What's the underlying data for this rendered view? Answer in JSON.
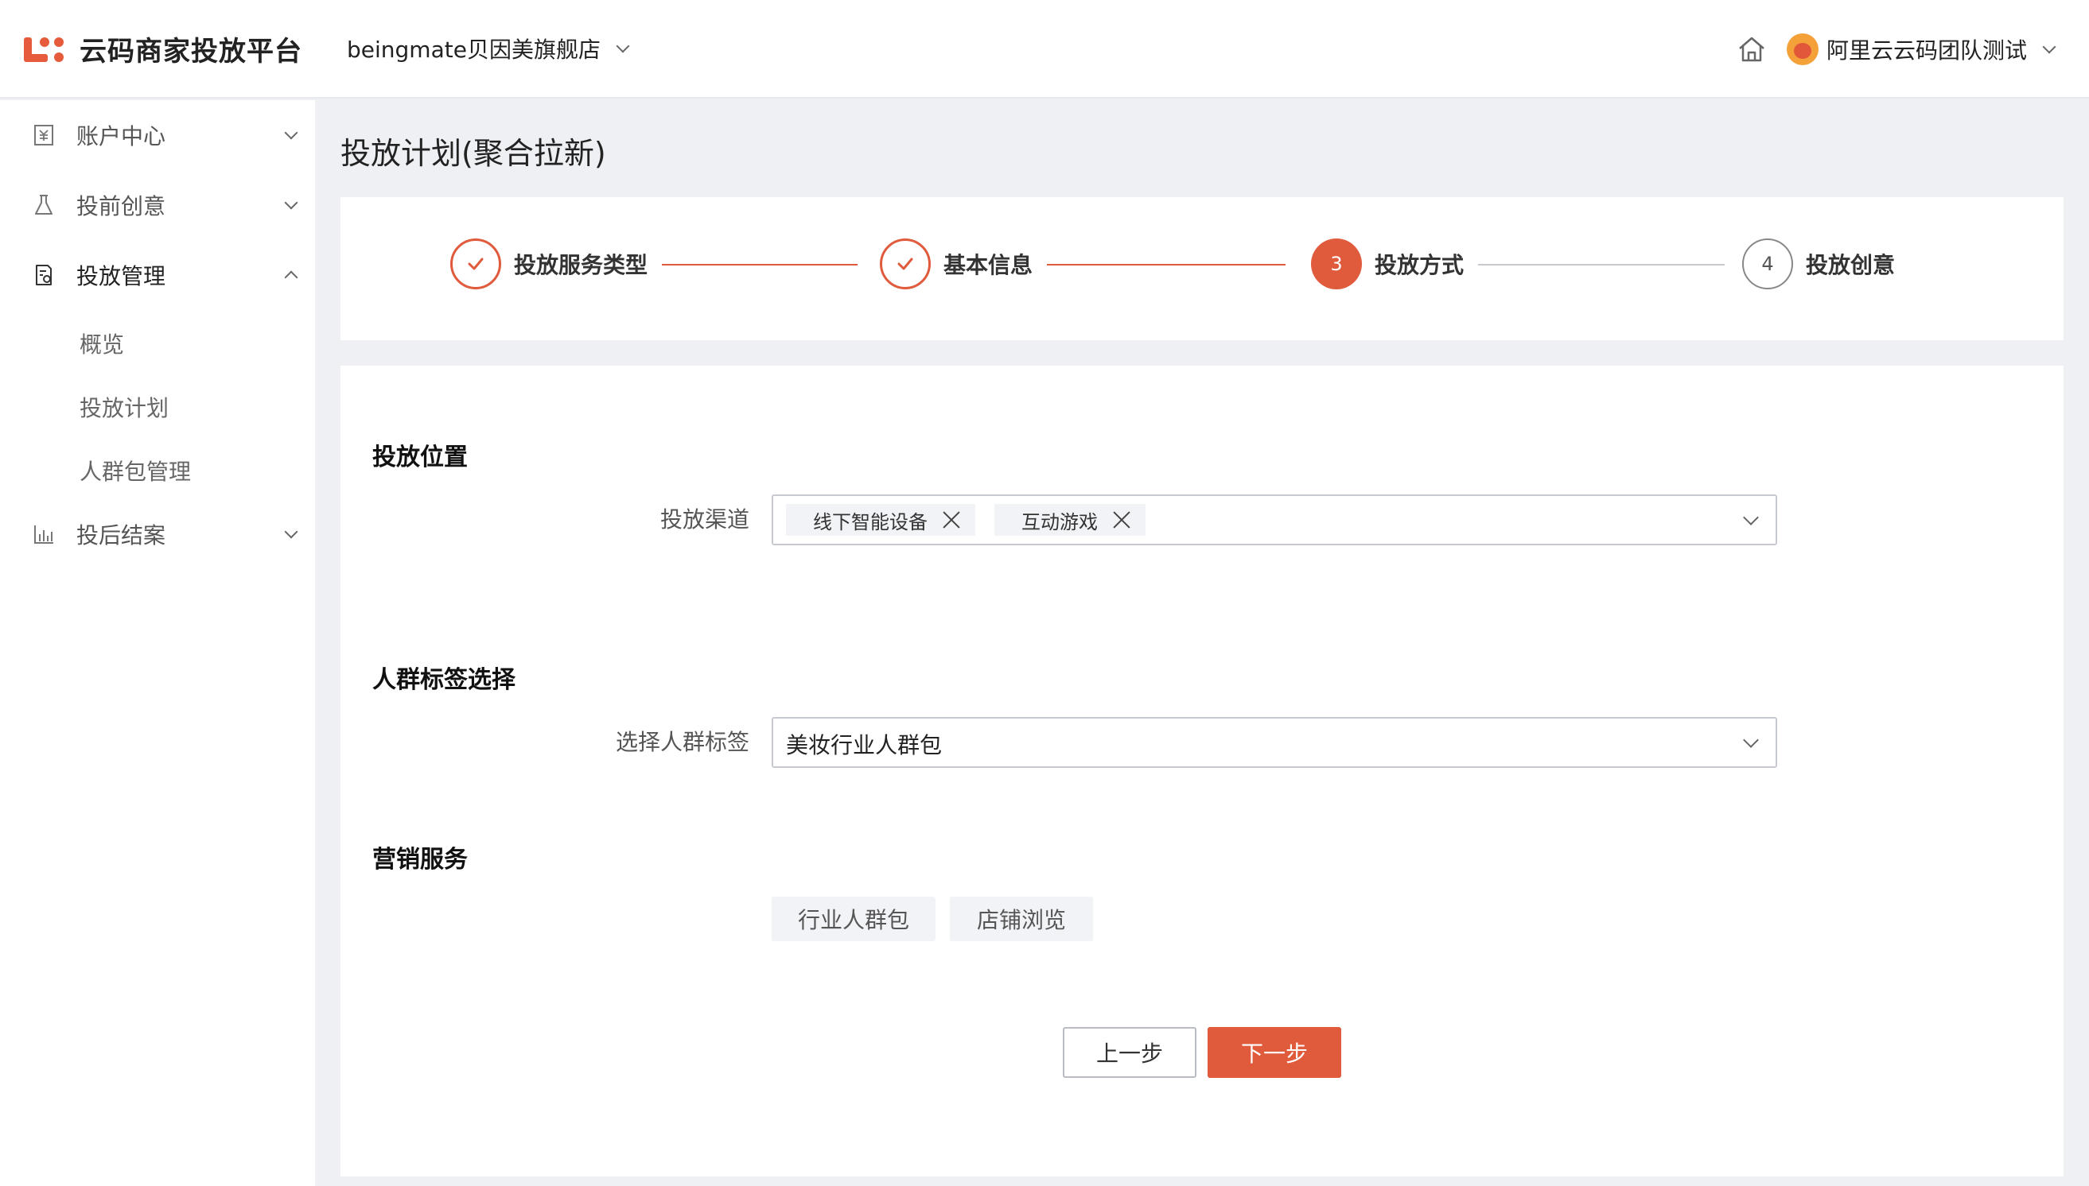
{
  "header": {
    "logo_text": "云码商家投放平台",
    "store_name": "beingmate贝因美旗舰店",
    "user_name": "阿里云云码团队测试"
  },
  "sidebar": {
    "items": [
      {
        "label": "账户中心",
        "icon": "account-icon"
      },
      {
        "label": "投前创意",
        "icon": "flask-icon"
      },
      {
        "label": "投放管理",
        "icon": "document-icon"
      },
      {
        "label": "投后结案",
        "icon": "bar-chart-icon"
      }
    ],
    "subitems": [
      "概览",
      "投放计划",
      "人群包管理"
    ]
  },
  "page_title": "投放计划(聚合拉新)",
  "steps": [
    {
      "label": "投放服务类型",
      "status": "done"
    },
    {
      "label": "基本信息",
      "status": "done"
    },
    {
      "number": "3",
      "label": "投放方式",
      "status": "current"
    },
    {
      "number": "4",
      "label": "投放创意",
      "status": "todo"
    }
  ],
  "form": {
    "placement": {
      "title": "投放位置",
      "channel_label": "投放渠道",
      "tags": [
        "线下智能设备",
        "互动游戏"
      ]
    },
    "audience": {
      "title": "人群标签选择",
      "label": "选择人群标签",
      "value": "美妆行业人群包"
    },
    "marketing": {
      "title": "营销服务",
      "options": [
        "行业人群包",
        "店铺浏览"
      ]
    }
  },
  "buttons": {
    "prev": "上一步",
    "next": "下一步"
  },
  "colors": {
    "accent": "#e05a3c"
  }
}
